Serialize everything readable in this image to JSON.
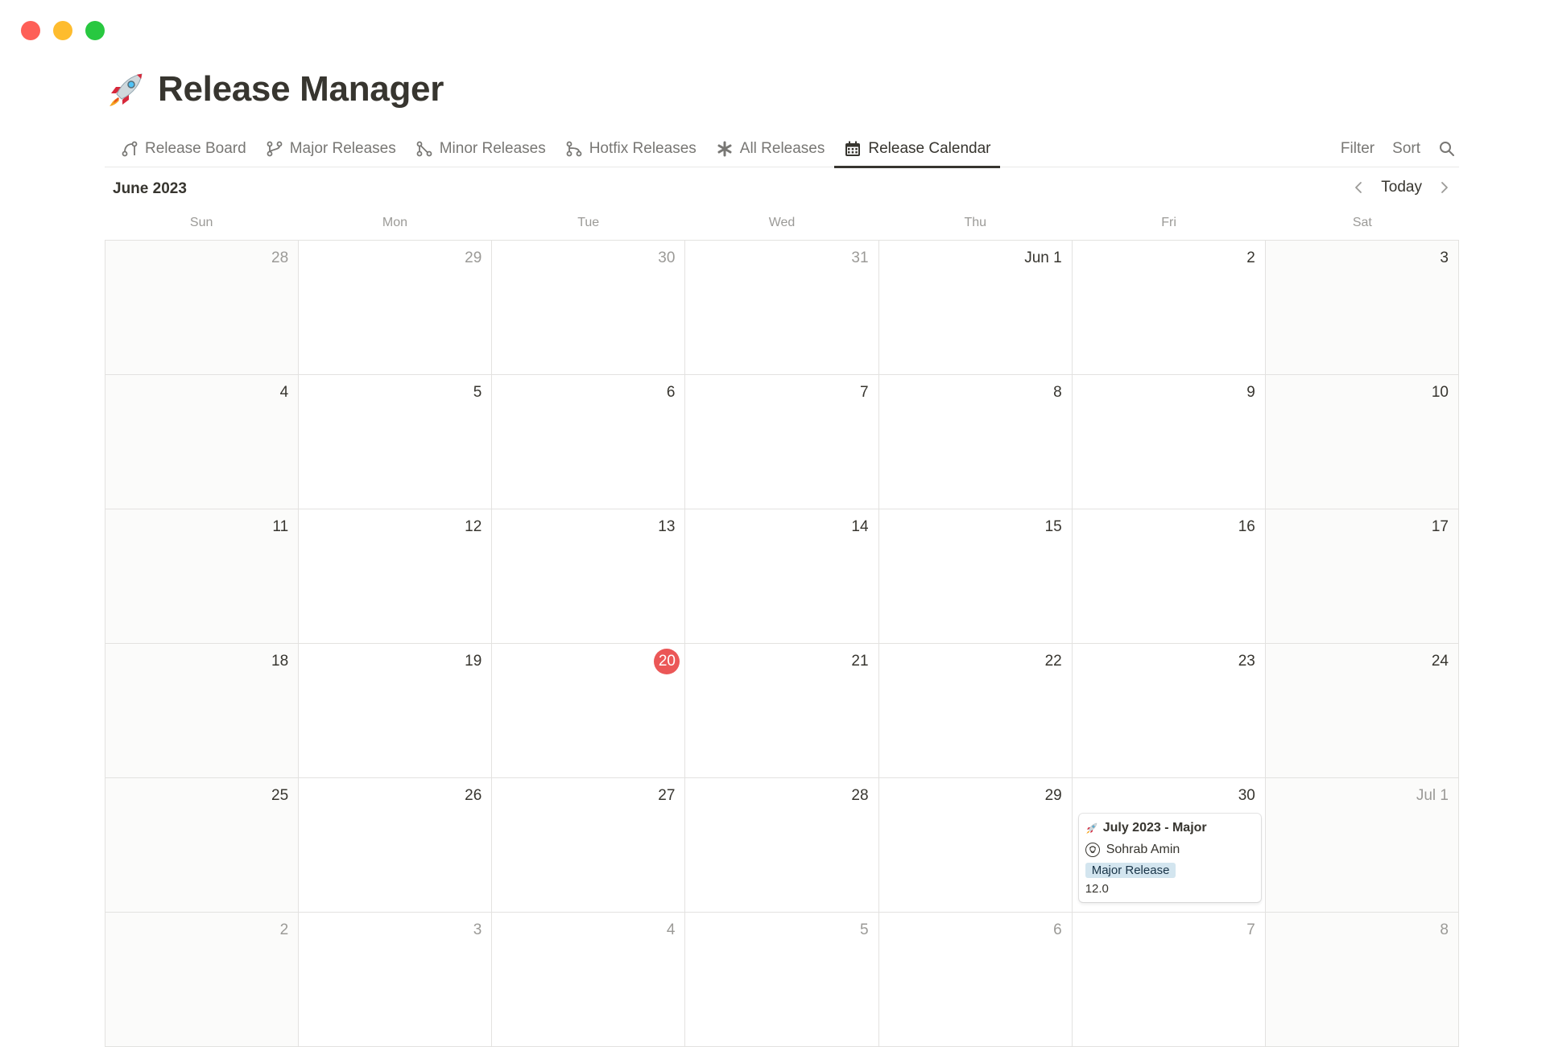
{
  "page": {
    "title": "Release Manager",
    "icon": "rocket-icon"
  },
  "tabs": [
    {
      "label": "Release Board",
      "icon": "board-icon",
      "active": false
    },
    {
      "label": "Major Releases",
      "icon": "branch-icon",
      "active": false
    },
    {
      "label": "Minor Releases",
      "icon": "branch-merge-icon",
      "active": false
    },
    {
      "label": "Hotfix Releases",
      "icon": "branch-fork-icon",
      "active": false
    },
    {
      "label": "All Releases",
      "icon": "asterisk-icon",
      "active": false
    },
    {
      "label": "Release Calendar",
      "icon": "calendar-icon",
      "active": true
    }
  ],
  "actions": {
    "filter": "Filter",
    "sort": "Sort"
  },
  "calendar": {
    "month_label": "June 2023",
    "today_label": "Today",
    "weekdays": [
      "Sun",
      "Mon",
      "Tue",
      "Wed",
      "Thu",
      "Fri",
      "Sat"
    ],
    "days": [
      {
        "label": "28",
        "muted": true
      },
      {
        "label": "29",
        "muted": true
      },
      {
        "label": "30",
        "muted": true
      },
      {
        "label": "31",
        "muted": true
      },
      {
        "label": "Jun 1"
      },
      {
        "label": "2"
      },
      {
        "label": "3"
      },
      {
        "label": "4"
      },
      {
        "label": "5"
      },
      {
        "label": "6"
      },
      {
        "label": "7"
      },
      {
        "label": "8"
      },
      {
        "label": "9"
      },
      {
        "label": "10"
      },
      {
        "label": "11"
      },
      {
        "label": "12"
      },
      {
        "label": "13"
      },
      {
        "label": "14"
      },
      {
        "label": "15"
      },
      {
        "label": "16"
      },
      {
        "label": "17"
      },
      {
        "label": "18"
      },
      {
        "label": "19"
      },
      {
        "label": "20",
        "today": true
      },
      {
        "label": "21"
      },
      {
        "label": "22"
      },
      {
        "label": "23"
      },
      {
        "label": "24"
      },
      {
        "label": "25"
      },
      {
        "label": "26"
      },
      {
        "label": "27"
      },
      {
        "label": "28"
      },
      {
        "label": "29"
      },
      {
        "label": "30"
      },
      {
        "label": "Jul 1",
        "muted": true
      },
      {
        "label": "2",
        "muted": true
      },
      {
        "label": "3",
        "muted": true
      },
      {
        "label": "4",
        "muted": true
      },
      {
        "label": "5",
        "muted": true
      },
      {
        "label": "6",
        "muted": true
      },
      {
        "label": "7",
        "muted": true
      },
      {
        "label": "8",
        "muted": true
      }
    ],
    "event": {
      "title": "July 2023 - Major",
      "icon": "rocket-icon",
      "person": "Sohrab Amin",
      "tag": "Major Release",
      "tag_color": "#d3e5ef",
      "version": "12.0",
      "day_label": "30"
    },
    "today_color": "#eb5757"
  }
}
